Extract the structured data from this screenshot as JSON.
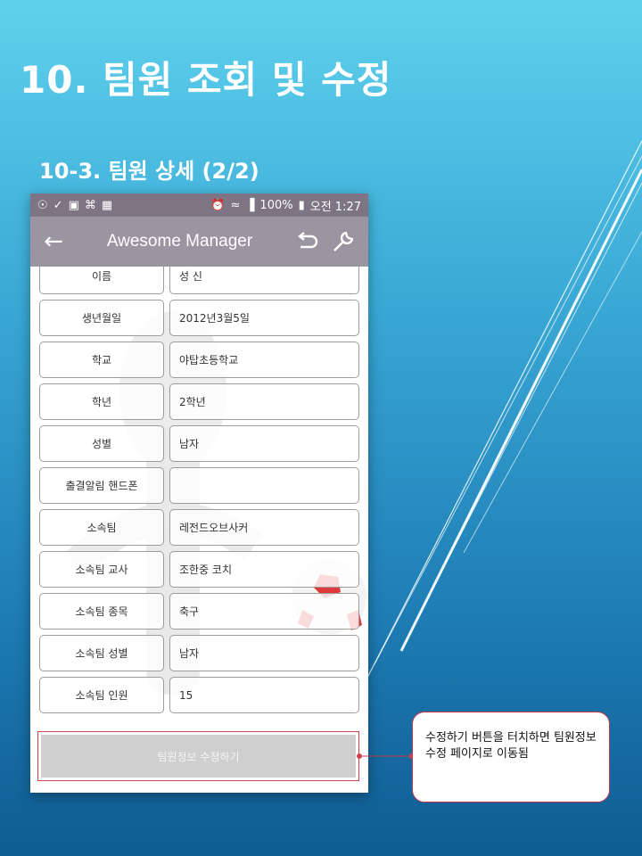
{
  "slide": {
    "title": "10. 팀원 조회 및 수정",
    "subtitle": "10-3. 팀원 상세 (2/2)"
  },
  "statusbar": {
    "battery": "100%",
    "time": "오전 1:27"
  },
  "appbar": {
    "title": "Awesome Manager",
    "back_icon": "arrow-left-icon",
    "undo_icon": "undo-icon",
    "settings_icon": "wrench-icon"
  },
  "details": [
    {
      "label": "이름",
      "value": "성 신"
    },
    {
      "label": "생년월일",
      "value": "2012년3월5일"
    },
    {
      "label": "학교",
      "value": "야탑초등학교"
    },
    {
      "label": "학년",
      "value": "2학년"
    },
    {
      "label": "성별",
      "value": "남자"
    },
    {
      "label": "출결알림 핸드폰",
      "value": ""
    },
    {
      "label": "소속팀",
      "value": "레전드오브사커"
    },
    {
      "label": "소속팀 교사",
      "value": "조한중 코치"
    },
    {
      "label": "소속팀 종목",
      "value": "축구"
    },
    {
      "label": "소속팀 성별",
      "value": "남자"
    },
    {
      "label": "소속팀 인원",
      "value": "15"
    }
  ],
  "edit_button": {
    "label": "팀원정보 수정하기"
  },
  "callout": {
    "text": "수정하기 버튼을 터치하면 팀원정보 수정 페이지로 이동됨"
  },
  "colors": {
    "statusbar": "#7d7583",
    "appbar": "#9a95a0",
    "highlight": "#d4424e"
  }
}
